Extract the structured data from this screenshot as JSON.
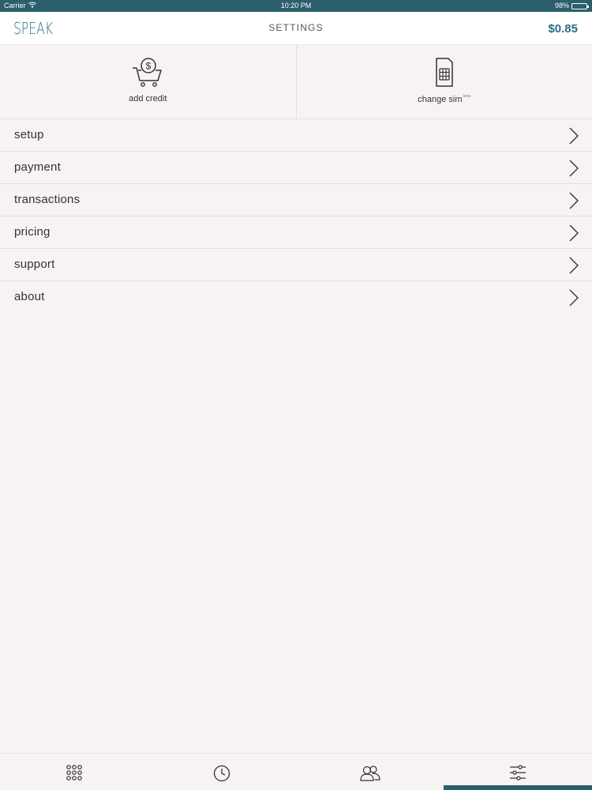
{
  "status_bar": {
    "carrier": "Carrier",
    "time": "10:20 PM",
    "battery_percent": "98%",
    "battery_level": 0.98
  },
  "header": {
    "logo": "SPEAK",
    "title": "SETTINGS",
    "balance": "$0.85"
  },
  "quick_actions": {
    "add_credit": {
      "label": "add credit",
      "icon": "cart-dollar-icon"
    },
    "change_sim": {
      "label": "change sim",
      "badge": "beta",
      "icon": "sim-card-icon"
    }
  },
  "menu": {
    "items": [
      {
        "label": "setup"
      },
      {
        "label": "payment"
      },
      {
        "label": "transactions"
      },
      {
        "label": "pricing"
      },
      {
        "label": "support"
      },
      {
        "label": "about"
      }
    ]
  },
  "tab_bar": {
    "tabs": [
      {
        "icon": "keypad-icon"
      },
      {
        "icon": "clock-icon"
      },
      {
        "icon": "contacts-icon"
      },
      {
        "icon": "sliders-icon",
        "active": true
      }
    ]
  },
  "colors": {
    "accent": "#2a6f80",
    "status_bar": "#2b5f6b",
    "background": "#f7f3f2"
  }
}
